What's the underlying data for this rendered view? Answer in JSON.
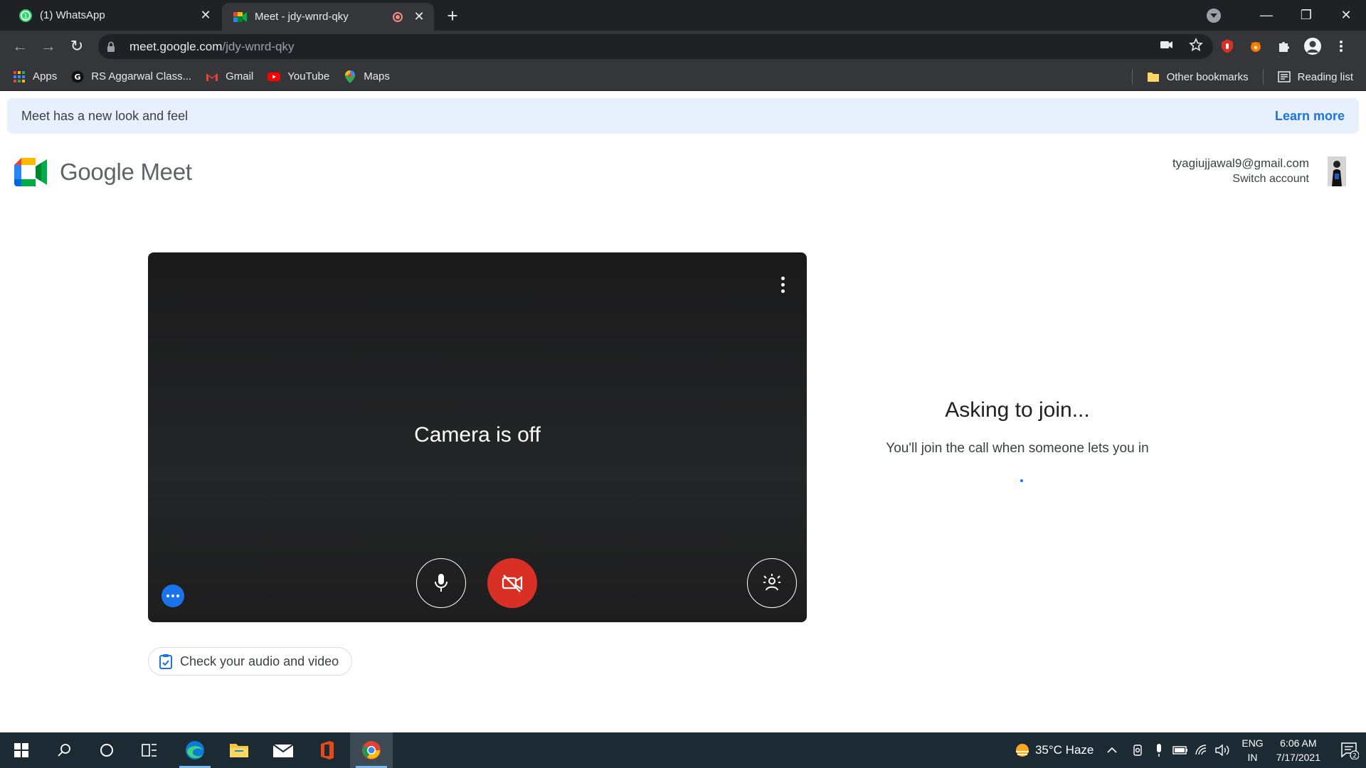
{
  "browser": {
    "tabs": [
      {
        "title": "(1) WhatsApp",
        "active": false
      },
      {
        "title": "Meet - jdy-wnrd-qky",
        "active": true
      }
    ],
    "url_host": "meet.google.com",
    "url_path": "/jdy-wnrd-qky",
    "bookmarks_left": [
      {
        "label": "Apps",
        "icon": "apps-grid-icon"
      },
      {
        "label": "RS Aggarwal Class...",
        "icon": "g-letter-icon"
      },
      {
        "label": "Gmail",
        "icon": "gmail-icon"
      },
      {
        "label": "YouTube",
        "icon": "youtube-icon"
      },
      {
        "label": "Maps",
        "icon": "maps-pin-icon"
      }
    ],
    "bookmarks_right": [
      {
        "label": "Other bookmarks",
        "icon": "folder-icon"
      },
      {
        "label": "Reading list",
        "icon": "reading-list-icon"
      }
    ]
  },
  "banner": {
    "message": "Meet has a new look and feel",
    "link": "Learn more"
  },
  "header": {
    "product_name": "Google Meet",
    "account_email": "tyagiujjawal9@gmail.com",
    "switch_account": "Switch account"
  },
  "preview": {
    "camera_status": "Camera is off",
    "mic_on": true,
    "camera_on": false
  },
  "check_av": {
    "label": "Check your audio and video"
  },
  "status": {
    "heading": "Asking to join...",
    "message": "You'll join the call when someone lets you in"
  },
  "taskbar": {
    "weather": "35°C  Haze",
    "lang_line1": "ENG",
    "lang_line2": "IN",
    "time": "6:06 AM",
    "date": "7/17/2021",
    "notification_count": "2"
  },
  "colors": {
    "accent": "#1a73e8",
    "danger": "#d93025",
    "banner_bg": "#e8f0fe"
  }
}
